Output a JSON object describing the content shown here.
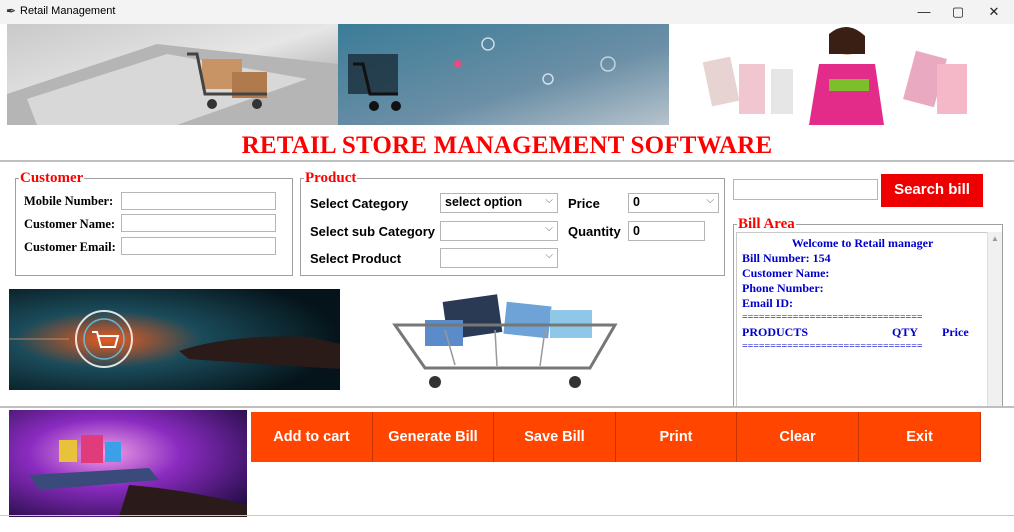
{
  "window": {
    "title": "Retail Management",
    "controls": [
      "—",
      "▢",
      "✕"
    ]
  },
  "header": {
    "title": "RETAIL STORE MANAGEMENT SOFTWARE"
  },
  "customer": {
    "legend": "Customer",
    "mobile_label": "Mobile Number:",
    "name_label": "Customer Name:",
    "email_label": "Customer Email:",
    "mobile_value": "",
    "name_value": "",
    "email_value": ""
  },
  "product": {
    "legend": "Product",
    "category_label": "Select Category",
    "category_value": "select option",
    "subcategory_label": "Select sub Category",
    "subcategory_value": "",
    "product_label": "Select Product",
    "product_value": "",
    "price_label": "Price",
    "price_value": "0",
    "quantity_label": "Quantity",
    "quantity_value": "0"
  },
  "search": {
    "input_value": "",
    "button_label": "Search bill"
  },
  "bill": {
    "legend": "Bill Area",
    "welcome": "Welcome to Retail manager",
    "bill_number": "Bill Number: 154",
    "customer_name": "Customer Name:",
    "phone_number": "Phone Number:",
    "email_id": "Email ID:",
    "separator": "================================",
    "col_products": "PRODUCTS",
    "col_qty": "QTY",
    "col_price": "Price"
  },
  "actions": {
    "add_to_cart": "Add to cart",
    "generate_bill": "Generate Bill",
    "save_bill": "Save Bill",
    "print": "Print",
    "clear": "Clear",
    "exit": "Exit"
  },
  "colors": {
    "title_red": "#ff0000",
    "action_orange": "#ff4500",
    "search_red": "#ee0000",
    "bill_blue": "#0000cc"
  }
}
